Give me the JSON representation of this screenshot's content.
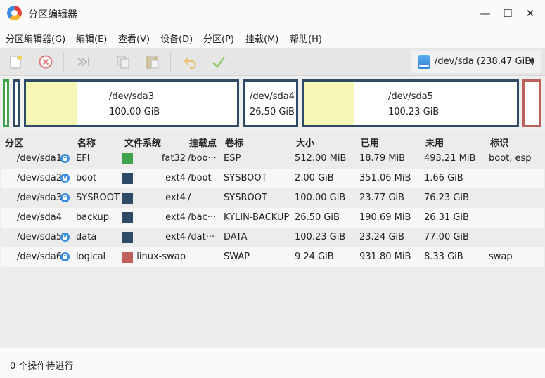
{
  "window": {
    "title": "分区编辑器",
    "controls": {
      "minimize": "—",
      "maximize": "☐",
      "close": "✕"
    }
  },
  "menu": [
    "分区编辑器(G)",
    "编辑(E)",
    "查看(V)",
    "设备(D)",
    "分区(P)",
    "挂载(M)",
    "帮助(H)"
  ],
  "toolbar": {
    "buttons": [
      "new-icon",
      "delete-icon",
      "resize-move-icon",
      "copy-icon",
      "paste-icon",
      "undo-icon",
      "apply-icon"
    ],
    "device": "/dev/sda  (238.47 GiB)"
  },
  "disk_map": [
    {
      "name": "/dev/sda3",
      "size": "100.00 GiB"
    },
    {
      "name": "/dev/sda4",
      "size": "26.50 GiB"
    },
    {
      "name": "/dev/sda5",
      "size": "100.23 GiB"
    }
  ],
  "table": {
    "headers": [
      "分区",
      "名称",
      "文件系统",
      "挂载点",
      "卷标",
      "大小",
      "已用",
      "未用",
      "标识"
    ],
    "rows": [
      {
        "partition": "/dev/sda1",
        "locked": true,
        "name": "EFI",
        "fs": "fat32",
        "fs_color": "#3fa34d",
        "mount": "/boo···",
        "label": "ESP",
        "size": "512.00 MiB",
        "used": "18.79 MiB",
        "unused": "493.21 MiB",
        "flags": "boot, esp"
      },
      {
        "partition": "/dev/sda2",
        "locked": true,
        "name": "boot",
        "fs": "ext4",
        "fs_color": "#2e4a66",
        "mount": "/boot",
        "label": "SYSBOOT",
        "size": "2.00 GiB",
        "used": "351.06 MiB",
        "unused": "1.66 GiB",
        "flags": ""
      },
      {
        "partition": "/dev/sda3",
        "locked": true,
        "name": "SYSROOT",
        "fs": "ext4",
        "fs_color": "#2e4a66",
        "mount": "/",
        "label": "SYSROOT",
        "size": "100.00 GiB",
        "used": "23.77 GiB",
        "unused": "76.23 GiB",
        "flags": ""
      },
      {
        "partition": "/dev/sda4",
        "locked": false,
        "name": "backup",
        "fs": "ext4",
        "fs_color": "#2e4a66",
        "mount": "/bac···",
        "label": "KYLIN-BACKUP",
        "size": "26.50 GiB",
        "used": "190.69 MiB",
        "unused": "26.31 GiB",
        "flags": ""
      },
      {
        "partition": "/dev/sda5",
        "locked": true,
        "name": "data",
        "fs": "ext4",
        "fs_color": "#2e4a66",
        "mount": "/dat···",
        "label": "DATA",
        "size": "100.23 GiB",
        "used": "23.24 GiB",
        "unused": "77.00 GiB",
        "flags": ""
      },
      {
        "partition": "/dev/sda6",
        "locked": true,
        "name": "logical",
        "fs": "linux-swap",
        "fs_color": "#c0605a",
        "mount": "",
        "label": "SWAP",
        "size": "9.24 GiB",
        "used": "931.80 MiB",
        "unused": "8.33 GiB",
        "flags": "swap"
      }
    ]
  },
  "status": "0 个操作待进行"
}
